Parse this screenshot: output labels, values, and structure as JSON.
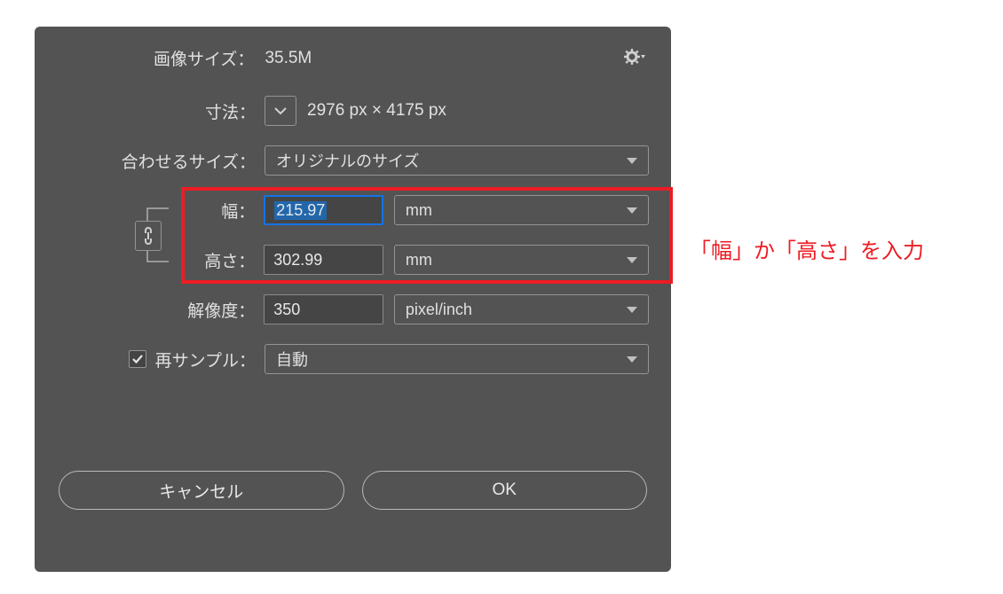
{
  "header": {
    "image_size_label": "画像サイズ：",
    "image_size_value": "35.5M"
  },
  "dimensions": {
    "label": "寸法：",
    "value": "2976 px × 4175 px"
  },
  "fit_to": {
    "label": "合わせるサイズ：",
    "selected": "オリジナルのサイズ"
  },
  "width": {
    "label": "幅：",
    "value": "215.97",
    "unit": "mm"
  },
  "height": {
    "label": "高さ：",
    "value": "302.99",
    "unit": "mm"
  },
  "resolution": {
    "label": "解像度：",
    "value": "350",
    "unit": "pixel/inch"
  },
  "resample": {
    "label": "再サンプル：",
    "selected": "自動",
    "checked": true
  },
  "buttons": {
    "cancel": "キャンセル",
    "ok": "OK"
  },
  "annotation": "「幅」か「高さ」を入力"
}
